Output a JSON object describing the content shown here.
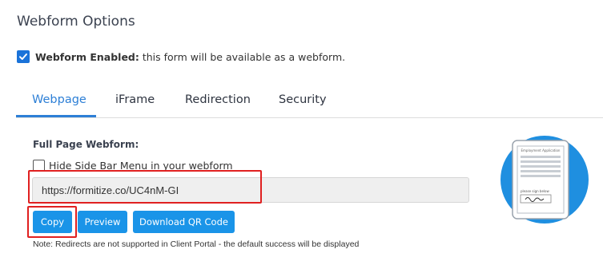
{
  "page": {
    "title": "Webform Options"
  },
  "webform_enabled": {
    "checked": true,
    "label_bold": "Webform Enabled:",
    "label_rest": " this form will be available as a webform."
  },
  "tabs": [
    {
      "label": "Webpage",
      "active": true
    },
    {
      "label": "iFrame",
      "active": false
    },
    {
      "label": "Redirection",
      "active": false
    },
    {
      "label": "Security",
      "active": false
    }
  ],
  "full_page": {
    "section_label": "Full Page Webform:",
    "hide_sidebar": {
      "checked": false,
      "label": "Hide Side Bar Menu in your webform"
    },
    "url_value": "https://formitize.co/UC4nM-GI",
    "buttons": {
      "copy": "Copy",
      "preview": "Preview",
      "download_qr": "Download QR Code"
    },
    "note": "Note: Redirects are not supported in Client Portal - the default success will be displayed"
  },
  "illustration": {
    "doc_title": "Employment Application",
    "sign_text": "please sign below"
  },
  "colors": {
    "accent": "#2d7fd6",
    "button": "#1a94e8",
    "highlight": "#e02020",
    "circle": "#1f8fe0"
  }
}
